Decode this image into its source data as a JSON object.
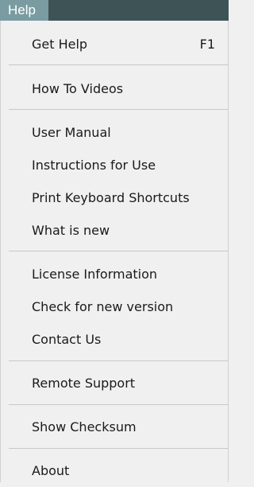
{
  "menubar": {
    "title": "Help"
  },
  "menu": {
    "items": [
      {
        "label": "Get Help",
        "shortcut": "F1"
      },
      {
        "label": "How To Videos"
      },
      {
        "label": "User Manual"
      },
      {
        "label": "Instructions for Use"
      },
      {
        "label": "Print Keyboard Shortcuts"
      },
      {
        "label": "What is new"
      },
      {
        "label": "License Information"
      },
      {
        "label": "Check for new version"
      },
      {
        "label": "Contact Us"
      },
      {
        "label": "Remote Support"
      },
      {
        "label": "Show Checksum"
      },
      {
        "label": "About"
      }
    ]
  },
  "colors": {
    "menubar_bg": "#3e5356",
    "menu_title_bg": "#7a9ba1",
    "menu_bg": "#f0f0f0",
    "separator": "#c8c8c8",
    "text": "#1a1a1a"
  }
}
